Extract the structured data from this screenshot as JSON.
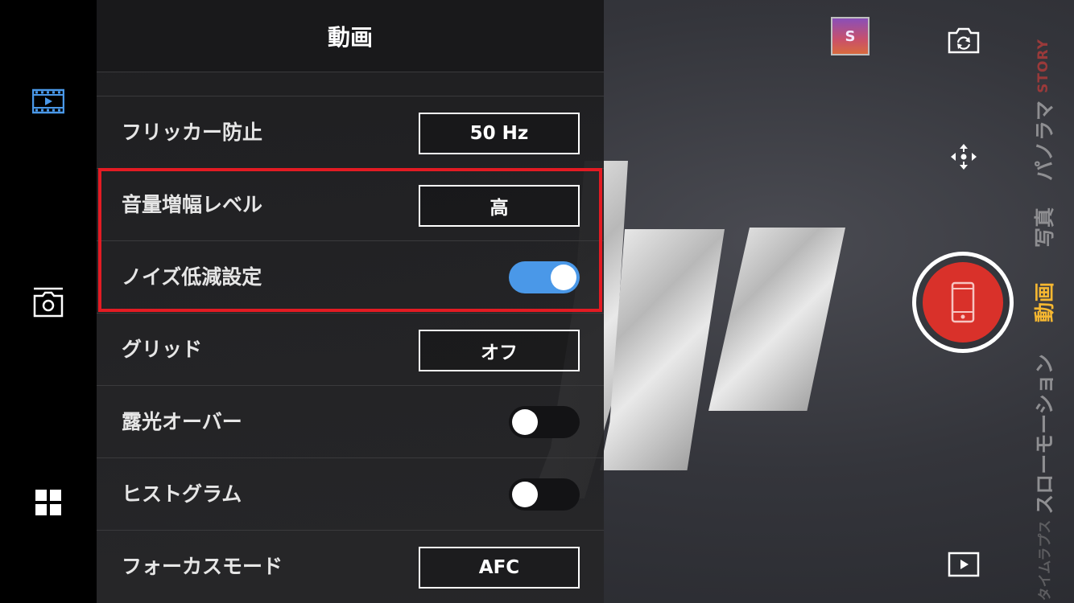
{
  "panel": {
    "title": "動画",
    "rows": [
      {
        "label": "フリッカー防止",
        "control": "value",
        "value": "50 Hz"
      },
      {
        "label": "音量増幅レベル",
        "control": "value",
        "value": "高"
      },
      {
        "label": "ノイズ低減設定",
        "control": "toggle",
        "on": true
      },
      {
        "label": "グリッド",
        "control": "value",
        "value": "オフ"
      },
      {
        "label": "露光オーバー",
        "control": "toggle",
        "on": false
      },
      {
        "label": "ヒストグラム",
        "control": "toggle",
        "on": false
      },
      {
        "label": "フォーカスモード",
        "control": "value",
        "value": "AFC"
      }
    ]
  },
  "gallery_thumbnail": {
    "letter": "S"
  },
  "modes": {
    "story": "STORY",
    "panorama": "パノラマ",
    "photo": "写真",
    "video": "動画",
    "slow_motion": "スローモーション",
    "time_lapse": "タイムラプス",
    "active": "video"
  },
  "colors": {
    "accent_blue": "#4a98e8",
    "shutter_red": "#d9312a",
    "highlight_red": "#e31b23",
    "active_mode": "#f5b731",
    "story": "#9a3a3a"
  },
  "icons": {
    "rail": [
      "video-mode-icon",
      "photo-mode-icon",
      "grid-menu-icon"
    ],
    "right": [
      "switch-camera-icon",
      "focus-icon",
      "shutter-phone-icon",
      "play-icon"
    ]
  }
}
